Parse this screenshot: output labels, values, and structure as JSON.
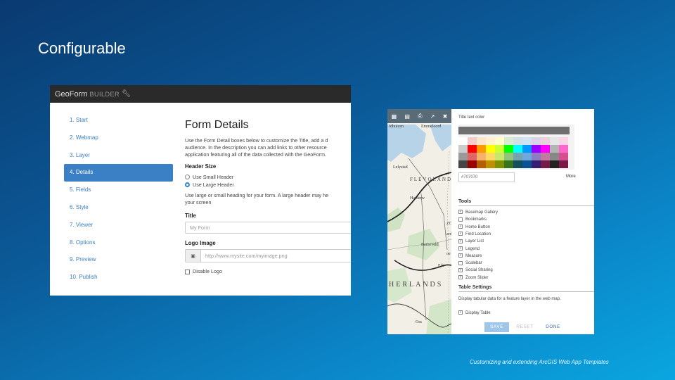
{
  "slide": {
    "title": "Configurable",
    "footer": "Customizing and extending ArcGIS Web App Templates"
  },
  "geoform": {
    "brand": "GeoForm",
    "brand_suffix": "BUILDER",
    "nav": [
      {
        "label": "1. Start",
        "active": false
      },
      {
        "label": "2. Webmap",
        "active": false
      },
      {
        "label": "3. Layer",
        "active": false
      },
      {
        "label": "4. Details",
        "active": true
      },
      {
        "label": "5. Fields",
        "active": false
      },
      {
        "label": "6. Style",
        "active": false
      },
      {
        "label": "7. Viewer",
        "active": false
      },
      {
        "label": "8. Options",
        "active": false
      },
      {
        "label": "9. Preview",
        "active": false
      },
      {
        "label": "10. Publish",
        "active": false
      }
    ],
    "heading": "Form Details",
    "description_lines": [
      "Use the Form Detail boxes below to customize the Title, add a d",
      "audience. In the description you can add links to other resource",
      "application featuring all of the data collected with the GeoForm."
    ],
    "header_size_label": "Header Size",
    "radio_small": "Use Small Header",
    "radio_large": "Use Large Header",
    "header_help_lines": [
      "Use large or small heading for your form. A large header may he",
      "your screen"
    ],
    "title_label": "Title",
    "title_value": "My Form",
    "logo_label": "Logo Image",
    "logo_placeholder": "http://www.mysite.com/myimage.png",
    "disable_logo": "Disable Logo"
  },
  "mapapp": {
    "map_labels": {
      "top_left": "Idhuizen",
      "top_mid": "Emmeloord",
      "lelystad": "Lelystad",
      "flevoland": "FLEVOLAND",
      "harderwijk": "Harderw",
      "barneveld": "Barneveld",
      "ede": "Ede",
      "herlands": "HERLANDS",
      "oss": "Oss",
      "s1": "ZC",
      "s2": "ard",
      "s3": "oe"
    },
    "title_text_color_label": "Title text color",
    "hex_value": "#707070",
    "more_label": "More",
    "tools_heading": "Tools",
    "tools": [
      {
        "label": "Basemap Gallery",
        "checked": true
      },
      {
        "label": "Bookmarks",
        "checked": false
      },
      {
        "label": "Home Button",
        "checked": true
      },
      {
        "label": "Find Location",
        "checked": true
      },
      {
        "label": "Layer List",
        "checked": true
      },
      {
        "label": "Legend",
        "checked": true
      },
      {
        "label": "Measure",
        "checked": true
      },
      {
        "label": "Scalebar",
        "checked": false
      },
      {
        "label": "Social Sharing",
        "checked": true
      },
      {
        "label": "Zoom Slider",
        "checked": true
      }
    ],
    "table_heading": "Table Settings",
    "table_help": "Display tabular data for a feature layer in the web map.",
    "display_table": "Display Table",
    "save": "SAVE",
    "reset": "RESET",
    "done": "DONE",
    "palette_colors": [
      "#ffffff",
      "#f4cccc",
      "#fce5cd",
      "#fff2cc",
      "#ffffcc",
      "#d9ead3",
      "#d0e0e3",
      "#cfe2f3",
      "#d9d2e9",
      "#ead1dc",
      "#e6e6e6",
      "#f9d6e6",
      "#cccccc",
      "#ff0000",
      "#ff9900",
      "#ffff00",
      "#ccff33",
      "#00ff00",
      "#00ffff",
      "#0099ff",
      "#9900ff",
      "#ff00ff",
      "#b4b4b4",
      "#ff66cc",
      "#999999",
      "#e06666",
      "#f6b26b",
      "#ffd966",
      "#c9e86a",
      "#93c47d",
      "#76a5af",
      "#6fa8dc",
      "#8e7cc3",
      "#c27ba0",
      "#888888",
      "#d5508f",
      "#444444",
      "#990000",
      "#b45f06",
      "#bf9000",
      "#7f9000",
      "#38761d",
      "#134f5c",
      "#0b5394",
      "#351c75",
      "#741b47",
      "#222222",
      "#7a1846"
    ]
  }
}
